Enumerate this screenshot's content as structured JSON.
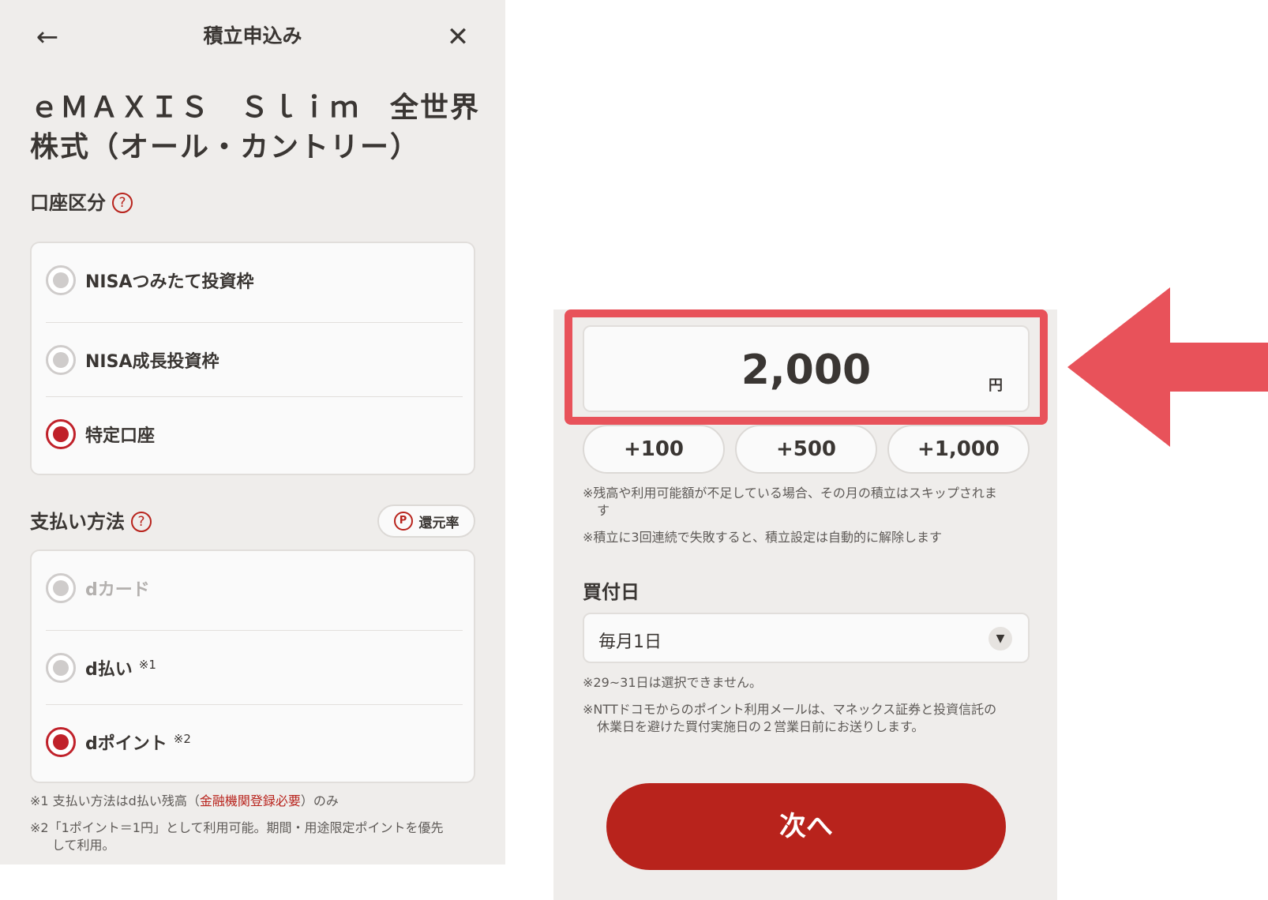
{
  "header": {
    "back_icon": "←",
    "title": "積立申込み",
    "close_icon": "✕"
  },
  "fund": {
    "name": "ｅＭＡＸＩＳ　Ｓｌｉｍ　全世界株式（オール・カントリー）"
  },
  "account": {
    "title": "口座区分",
    "help": "?",
    "options": [
      {
        "label": "NISAつみたて投資枠",
        "selected": false
      },
      {
        "label": "NISA成長投資枠",
        "selected": false
      },
      {
        "label": "特定口座",
        "selected": true
      }
    ]
  },
  "payment": {
    "title": "支払い方法",
    "help": "?",
    "rate_button": {
      "icon": "P",
      "label": "還元率"
    },
    "options": [
      {
        "label": "dカード",
        "note": "",
        "selected": false,
        "disabled": true
      },
      {
        "label": "d払い",
        "note": "※1",
        "selected": false,
        "disabled": false
      },
      {
        "label": "dポイント",
        "note": "※2",
        "selected": true,
        "disabled": false
      }
    ],
    "note1": {
      "prefix": "※1 支払い方法はd払い残高（",
      "link": "金融機関登録必要",
      "suffix": "）のみ"
    },
    "note2": {
      "line1": "※2「1ポイント＝1円」として利用可能。期間・用途限定ポイントを優先",
      "line2": "して利用。"
    }
  },
  "amount": {
    "value": "2,000",
    "unit": "円",
    "increments": [
      "+100",
      "+500",
      "+1,000"
    ],
    "notes": [
      {
        "line1": "※残高や利用可能額が不足している場合、その月の積立はスキップされま",
        "line2": "す"
      },
      {
        "line1": "※積立に3回連続で失敗すると、積立設定は自動的に解除します",
        "line2": ""
      }
    ]
  },
  "purchase_date": {
    "label": "買付日",
    "value": "毎月1日",
    "arrow_icon": "▼",
    "notes": [
      {
        "line1": "※29~31日は選択できません。",
        "line2": ""
      },
      {
        "line1": "※NTTドコモからのポイント利用メールは、マネックス証券と投資信託の",
        "line2": "休業日を避けた買付実施日の２営業日前にお送りします。"
      }
    ]
  },
  "next_button": {
    "label": "次へ"
  },
  "colors": {
    "accent": "#b8231c",
    "highlight": "#e8525a",
    "panel_bg": "#efedeb"
  }
}
